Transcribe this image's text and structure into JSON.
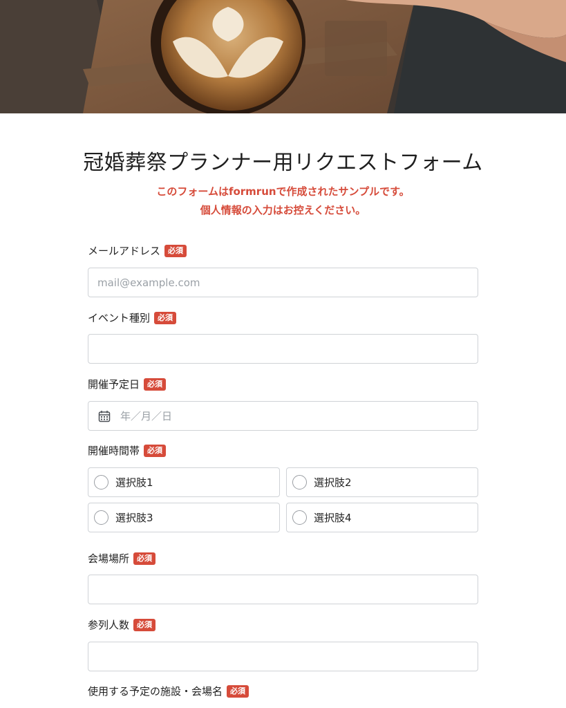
{
  "form": {
    "title": "冠婚葬祭プランナー用リクエストフォーム",
    "notice_line1": "このフォームはformrunで作成されたサンプルです。",
    "notice_line2": "個人情報の入力はお控えください。",
    "required_badge": "必須"
  },
  "fields": {
    "email": {
      "label": "メールアドレス",
      "placeholder": "mail@example.com",
      "value": ""
    },
    "event_type": {
      "label": "イベント種別",
      "value": ""
    },
    "event_date": {
      "label": "開催予定日",
      "placeholder": "年／月／日"
    },
    "time_slot": {
      "label": "開催時間帯",
      "options": [
        "選択肢1",
        "選択肢2",
        "選択肢3",
        "選択肢4"
      ]
    },
    "venue_location": {
      "label": "会場場所",
      "value": ""
    },
    "attendees": {
      "label": "参列人数",
      "value": ""
    },
    "facility_name": {
      "label": "使用する予定の施設・会場名"
    }
  },
  "colors": {
    "accent_red": "#d64b3a",
    "field_border": "#cfd2d6",
    "placeholder": "#9aa0a6"
  },
  "icons": {
    "date_field_icon": "calendar-icon",
    "radio_icon": "radio-circle-icon"
  }
}
